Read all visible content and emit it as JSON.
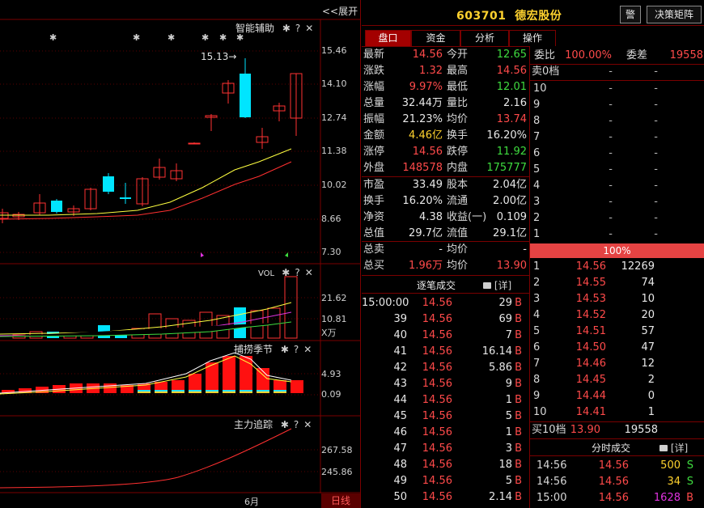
{
  "chart": {
    "expand_label": "<<展开",
    "panels": [
      {
        "title": "智能辅助"
      },
      {
        "title": "VOL"
      },
      {
        "title": "捕捞季节"
      },
      {
        "title": "主力追踪"
      }
    ],
    "panel_icons": [
      "gear-icon",
      "help-icon",
      "close-icon"
    ],
    "price_axis": [
      "15.46",
      "14.10",
      "12.74",
      "11.38",
      "10.02",
      "8.66",
      "7.30"
    ],
    "vol_axis": [
      "21.62",
      "10.81",
      "X万"
    ],
    "season_axis": [
      "4.93",
      "0.09"
    ],
    "track_axis": [
      "267.58",
      "245.86"
    ],
    "high_annotation": "15.13→",
    "month_label": "6月",
    "period_tab": "日线",
    "colors": {
      "up": "#ff3232",
      "down": "#00e5ff",
      "ma_fast": "#ffff40",
      "ma_slow": "#ff3030",
      "bg": "#000000"
    }
  },
  "header": {
    "code": "603701",
    "name": "德宏股份",
    "alert_button": "警",
    "matrix_button": "决策矩阵"
  },
  "tabs": [
    "盘口",
    "资金",
    "分析",
    "操作"
  ],
  "quote": [
    {
      "l1": "最新",
      "v1": "14.56",
      "l2": "今开",
      "v2": "12.65"
    },
    {
      "l1": "涨跌",
      "v1": "1.32",
      "l2": "最高",
      "v2": "14.56"
    },
    {
      "l1": "涨幅",
      "v1": "9.97%",
      "l2": "最低",
      "v2": "12.01"
    },
    {
      "l1": "总量",
      "v1": "32.44万",
      "l2": "量比",
      "v2": "2.16"
    },
    {
      "l1": "振幅",
      "v1": "21.23%",
      "l2": "均价",
      "v2": "13.74"
    },
    {
      "l1": "金额",
      "v1": "4.46亿",
      "l2": "换手",
      "v2": "16.20%"
    },
    {
      "l1": "涨停",
      "v1": "14.56",
      "l2": "跌停",
      "v2": "11.92"
    },
    {
      "l1": "外盘",
      "v1": "148578",
      "l2": "内盘",
      "v2": "175777"
    },
    {
      "l1": "市盈",
      "v1": "33.49",
      "l2": "股本",
      "v2": "2.04亿"
    },
    {
      "l1": "换手",
      "v1": "16.20%",
      "l2": "流通",
      "v2": "2.00亿"
    },
    {
      "l1": "净资",
      "v1": "4.38",
      "l2": "收益(一)",
      "v2": "0.109"
    },
    {
      "l1": "总值",
      "v1": "29.7亿",
      "l2": "流值",
      "v2": "29.1亿"
    },
    {
      "l1": "总卖",
      "v1": "-",
      "l2": "均价",
      "v2": "-"
    },
    {
      "l1": "总买",
      "v1": "1.96万",
      "l2": "均价",
      "v2": "13.90"
    }
  ],
  "ticks_title": "逐笔成交",
  "detail_label": "[详]",
  "ticks": [
    {
      "t": "15:00:00",
      "p": "14.56",
      "v": "29",
      "s": "B"
    },
    {
      "t": "39",
      "p": "14.56",
      "v": "69",
      "s": "B"
    },
    {
      "t": "40",
      "p": "14.56",
      "v": "7",
      "s": "B"
    },
    {
      "t": "41",
      "p": "14.56",
      "v": "16.14",
      "s": "B"
    },
    {
      "t": "42",
      "p": "14.56",
      "v": "5.86",
      "s": "B"
    },
    {
      "t": "43",
      "p": "14.56",
      "v": "9",
      "s": "B"
    },
    {
      "t": "44",
      "p": "14.56",
      "v": "1",
      "s": "B"
    },
    {
      "t": "45",
      "p": "14.56",
      "v": "5",
      "s": "B"
    },
    {
      "t": "46",
      "p": "14.56",
      "v": "1",
      "s": "B"
    },
    {
      "t": "47",
      "p": "14.56",
      "v": "3",
      "s": "B"
    },
    {
      "t": "48",
      "p": "14.56",
      "v": "18",
      "s": "B"
    },
    {
      "t": "49",
      "p": "14.56",
      "v": "5",
      "s": "B"
    },
    {
      "t": "50",
      "p": "14.56",
      "v": "2.14",
      "s": "B"
    }
  ],
  "book": {
    "ratio_label": "委比",
    "ratio_value": "100.00%",
    "diff_label": "委差",
    "diff_value": "19558",
    "sell_header": "卖0档",
    "sell_header_a": "-",
    "sell_header_b": "-",
    "sells": [
      {
        "n": "10",
        "p": "-",
        "v": "-"
      },
      {
        "n": "9",
        "p": "-",
        "v": "-"
      },
      {
        "n": "8",
        "p": "-",
        "v": "-"
      },
      {
        "n": "7",
        "p": "-",
        "v": "-"
      },
      {
        "n": "6",
        "p": "-",
        "v": "-"
      },
      {
        "n": "5",
        "p": "-",
        "v": "-"
      },
      {
        "n": "4",
        "p": "-",
        "v": "-"
      },
      {
        "n": "3",
        "p": "-",
        "v": "-"
      },
      {
        "n": "2",
        "p": "-",
        "v": "-"
      },
      {
        "n": "1",
        "p": "-",
        "v": "-"
      }
    ],
    "pct_bar": "100%",
    "buys": [
      {
        "n": "1",
        "p": "14.56",
        "v": "12269"
      },
      {
        "n": "2",
        "p": "14.55",
        "v": "74"
      },
      {
        "n": "3",
        "p": "14.53",
        "v": "10"
      },
      {
        "n": "4",
        "p": "14.52",
        "v": "20"
      },
      {
        "n": "5",
        "p": "14.51",
        "v": "57"
      },
      {
        "n": "6",
        "p": "14.50",
        "v": "47"
      },
      {
        "n": "7",
        "p": "14.46",
        "v": "12"
      },
      {
        "n": "8",
        "p": "14.45",
        "v": "2"
      },
      {
        "n": "9",
        "p": "14.44",
        "v": "0"
      },
      {
        "n": "10",
        "p": "14.41",
        "v": "1"
      }
    ],
    "buy_footer_label": "买10档",
    "buy_footer_price": "13.90",
    "buy_footer_vol": "19558"
  },
  "minute_title": "分时成交",
  "minute": [
    {
      "t": "14:56",
      "p": "14.56",
      "v": "500",
      "s": "S"
    },
    {
      "t": "14:56",
      "p": "14.56",
      "v": "34",
      "s": "S"
    },
    {
      "t": "15:00",
      "p": "14.56",
      "v": "1628",
      "s": "B"
    }
  ]
}
